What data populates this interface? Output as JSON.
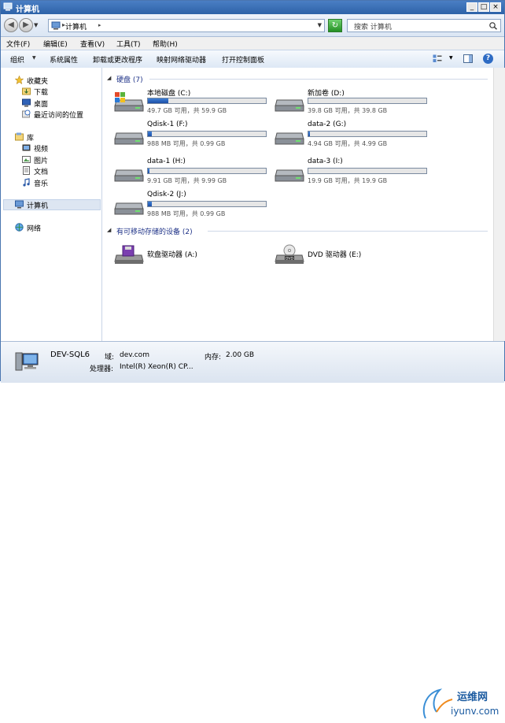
{
  "window": {
    "title": "计算机"
  },
  "address": {
    "crumb": "计算机",
    "crumb_arrow": "▸"
  },
  "search": {
    "placeholder": "搜索 计算机"
  },
  "menu": {
    "file": "文件(F)",
    "edit": "编辑(E)",
    "view": "查看(V)",
    "tools": "工具(T)",
    "help": "帮助(H)"
  },
  "toolbar": {
    "organize": "组织",
    "system_properties": "系统属性",
    "uninstall": "卸载或更改程序",
    "map_drive": "映射网络驱动器",
    "control_panel": "打开控制面板"
  },
  "nav": {
    "favorites": "收藏夹",
    "downloads": "下载",
    "desktop": "桌面",
    "recent": "最近访问的位置",
    "libraries": "库",
    "videos": "视频",
    "pictures": "图片",
    "documents": "文档",
    "music": "音乐",
    "computer": "计算机",
    "network": "网络"
  },
  "groups": {
    "hard_disks": "硬盘 (7)",
    "removable": "有可移动存储的设备 (2)"
  },
  "drives": [
    {
      "name": "本地磁盘 (C:)",
      "info": "49.7 GB 可用，共 59.9 GB",
      "used_fraction": 0.17,
      "icon": "windows-drive-icon"
    },
    {
      "name": "新加卷 (D:)",
      "info": "39.8 GB 可用，共 39.8 GB",
      "used_fraction": 0.0,
      "icon": "hard-drive-icon"
    },
    {
      "name": "Qdisk-1 (F:)",
      "info": "988 MB 可用，共 0.99 GB",
      "used_fraction": 0.03,
      "icon": "hard-drive-icon"
    },
    {
      "name": "data-2 (G:)",
      "info": "4.94 GB 可用，共 4.99 GB",
      "used_fraction": 0.01,
      "icon": "hard-drive-icon"
    },
    {
      "name": "data-1 (H:)",
      "info": "9.91 GB 可用，共 9.99 GB",
      "used_fraction": 0.01,
      "icon": "hard-drive-icon"
    },
    {
      "name": "data-3 (I:)",
      "info": "19.9 GB 可用，共 19.9 GB",
      "used_fraction": 0.0,
      "icon": "hard-drive-icon"
    },
    {
      "name": "Qdisk-2 (J:)",
      "info": "988 MB 可用，共 0.99 GB",
      "used_fraction": 0.03,
      "icon": "hard-drive-icon"
    }
  ],
  "removable": [
    {
      "name": "软盘驱动器 (A:)",
      "icon": "floppy-drive-icon"
    },
    {
      "name": "DVD 驱动器 (E:)",
      "icon": "dvd-drive-icon"
    }
  ],
  "details": {
    "computer_name": "DEV-SQL6",
    "domain_label": "域:",
    "domain_value": "dev.com",
    "memory_label": "内存:",
    "memory_value": "2.00 GB",
    "cpu_label": "处理器:",
    "cpu_value": "Intel(R) Xeon(R) CP..."
  },
  "watermark": {
    "line1": "运维网",
    "line2": "iyunv.com"
  },
  "colors": {
    "accent": "#2e63a8",
    "bar_fill": "#1d4fa6",
    "group_header": "#1e3287"
  }
}
